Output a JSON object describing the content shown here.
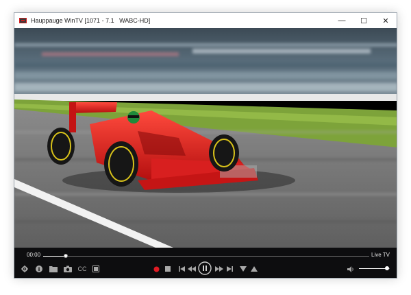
{
  "window": {
    "title": "Hauppauge WinTV [1071 - 7.1   WABC-HD]",
    "minimize_glyph": "—",
    "maximize_glyph": "☐",
    "close_glyph": "✕"
  },
  "video": {
    "description_icon": "race-car-video-frame"
  },
  "controls": {
    "elapsed": "00:00",
    "live_label": "Live TV",
    "seek_progress": 0.07,
    "volume_level": 0.9,
    "cc_label": "CC",
    "icons": {
      "settings": "gear-icon",
      "info": "info-icon",
      "folder": "folder-icon",
      "snapshot": "camera-icon",
      "captions": "cc-icon",
      "aspect": "aspect-ratio-icon",
      "record": "record-icon",
      "stop": "stop-icon",
      "skip_back": "skip-back-icon",
      "rewind": "rewind-icon",
      "pause": "pause-icon",
      "fast_forward": "fast-forward-icon",
      "skip_forward": "skip-forward-icon",
      "channel_down": "channel-down-icon",
      "channel_up": "channel-up-icon",
      "volume": "volume-icon"
    },
    "colors": {
      "record": "#e01b24",
      "icon": "#a8a8a8",
      "bar_bg": "#0d0d0f"
    }
  }
}
